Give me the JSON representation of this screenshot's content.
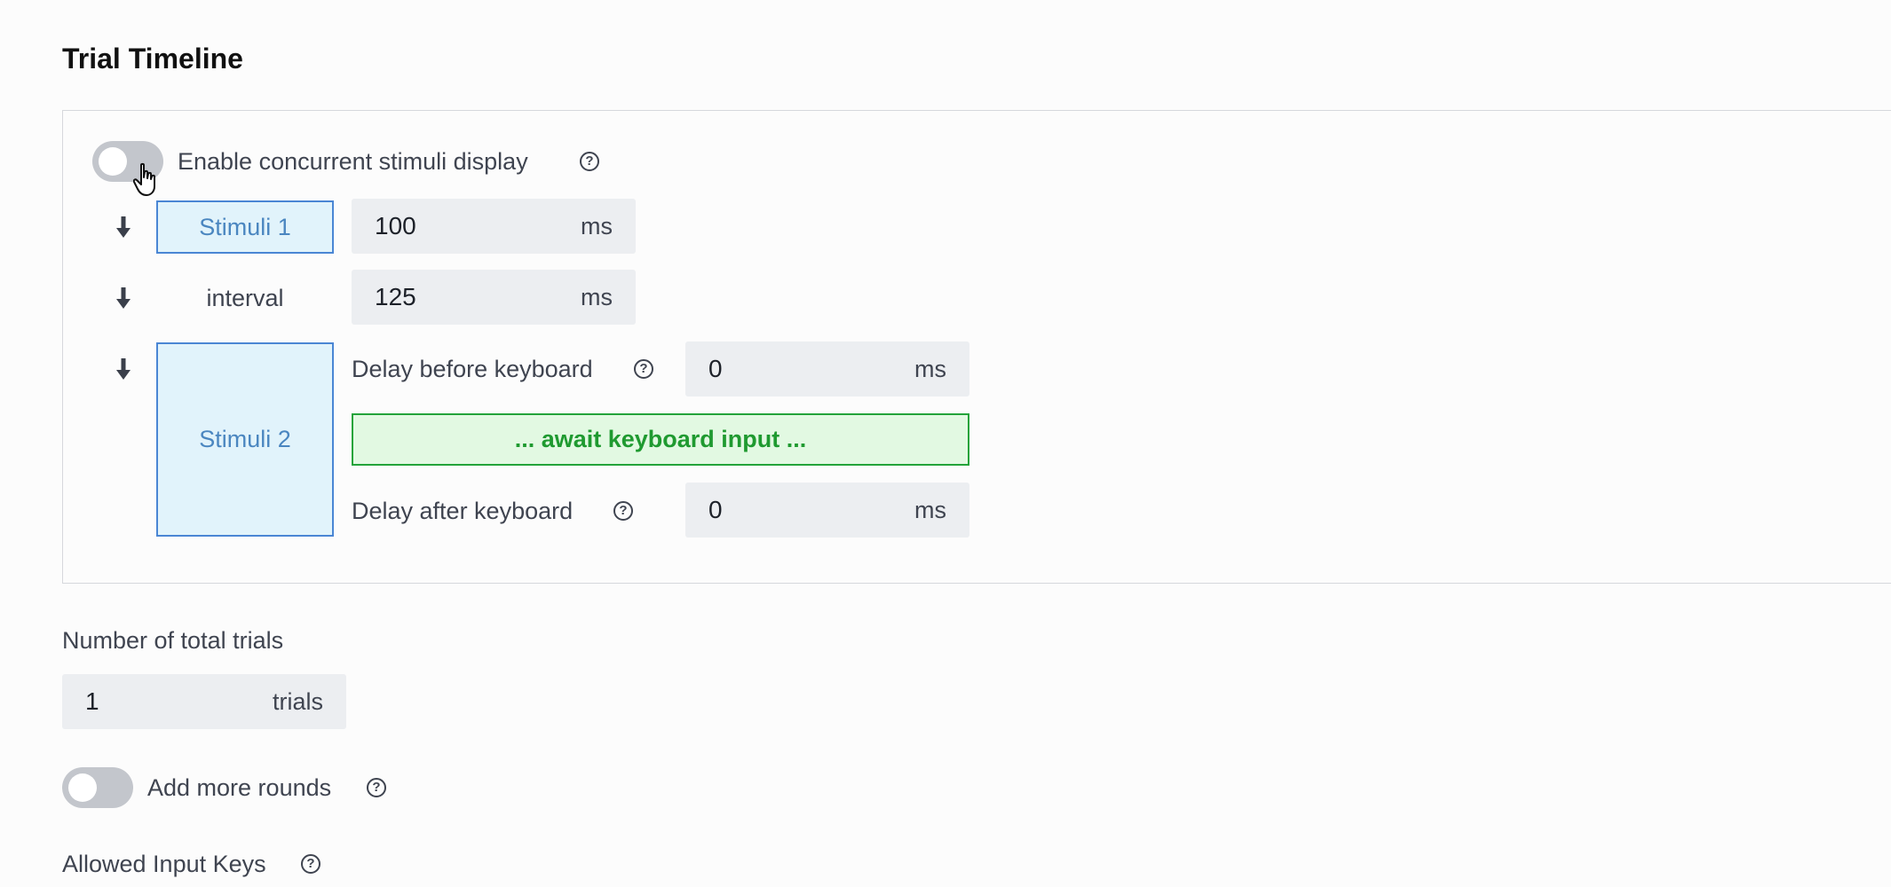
{
  "title": "Trial Timeline",
  "concurrent": {
    "label": "Enable concurrent stimuli display",
    "enabled": false
  },
  "timeline": {
    "stimuli1": {
      "label": "Stimuli 1",
      "value": "100",
      "unit": "ms"
    },
    "interval": {
      "label": "interval",
      "value": "125",
      "unit": "ms"
    },
    "stimuli2": {
      "label": "Stimuli 2",
      "delay_before_label": "Delay before keyboard",
      "delay_before_value": "0",
      "delay_before_unit": "ms",
      "await_label": "... await keyboard input ...",
      "delay_after_label": "Delay after keyboard",
      "delay_after_value": "0",
      "delay_after_unit": "ms"
    }
  },
  "trials": {
    "label": "Number of total trials",
    "value": "1",
    "unit": "trials"
  },
  "rounds": {
    "label": "Add more rounds",
    "enabled": false
  },
  "allowed_keys": {
    "label": "Allowed Input Keys"
  },
  "colors": {
    "stimuli_fill": "#e1f3fb",
    "stimuli_border": "#4a86d4",
    "await_fill": "#e2f9e2",
    "await_border": "#23a33a",
    "toggle_off": "#c3c6cc"
  }
}
